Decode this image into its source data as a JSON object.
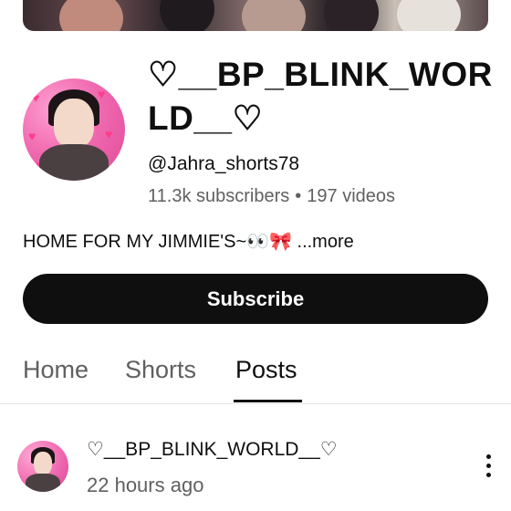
{
  "channel": {
    "title": "♡__BP_BLINK_WORLD__♡",
    "handle": "@Jahra_shorts78",
    "subscribers": "11.3k subscribers",
    "separator": "•",
    "videos": "197 videos",
    "description": "HOME FOR MY JIMMIE'S~👀🎀",
    "more_label": "...more"
  },
  "subscribe_label": "Subscribe",
  "tabs": [
    {
      "label": "Home",
      "active": false
    },
    {
      "label": "Shorts",
      "active": false
    },
    {
      "label": "Posts",
      "active": true
    }
  ],
  "post": {
    "author": "♡__BP_BLINK_WORLD__♡",
    "time": "22 hours ago"
  },
  "icons": {
    "more_options": "kebab-menu-icon"
  },
  "colors": {
    "subscribe_bg": "#0f0f0f",
    "text_primary": "#0f0f0f",
    "text_secondary": "#606060",
    "avatar_pink": "#f06ab0"
  }
}
